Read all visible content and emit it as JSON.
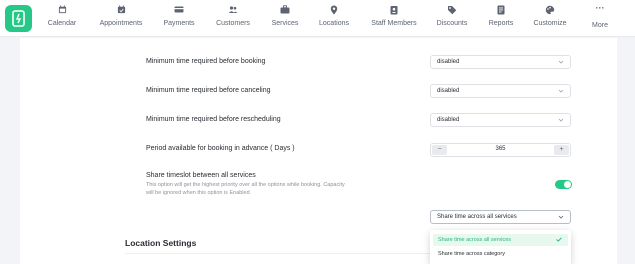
{
  "nav": {
    "items": [
      {
        "label": "Calendar",
        "icon": "calendar-icon"
      },
      {
        "label": "Appointments",
        "icon": "calendar-check-icon"
      },
      {
        "label": "Payments",
        "icon": "credit-card-icon"
      },
      {
        "label": "Customers",
        "icon": "users-icon"
      },
      {
        "label": "Services",
        "icon": "briefcase-icon"
      },
      {
        "label": "Locations",
        "icon": "map-pin-icon"
      },
      {
        "label": "Staff Members",
        "icon": "id-badge-icon"
      },
      {
        "label": "Discounts",
        "icon": "tag-icon"
      },
      {
        "label": "Reports",
        "icon": "report-icon"
      },
      {
        "label": "Customize",
        "icon": "palette-icon"
      }
    ],
    "more_label": "More"
  },
  "settings": {
    "min_before_booking": {
      "label": "Minimum time required before booking",
      "value": "disabled"
    },
    "min_before_canceling": {
      "label": "Minimum time required before canceling",
      "value": "disabled"
    },
    "min_before_rescheduling": {
      "label": "Minimum time required before rescheduling",
      "value": "disabled"
    },
    "advance_period": {
      "label": "Period available for booking in advance ( Days )",
      "value": "365",
      "minus": "−",
      "plus": "+"
    },
    "share_timeslot": {
      "label": "Share timeslot between all services",
      "description": "This option will get the highest priority over all the options while booking. Capacity will be ignored when this option is Enabled",
      "enabled": true,
      "value": "Share time across all services"
    }
  },
  "dropdown": {
    "options": [
      {
        "label": "Share time across all services",
        "selected": true
      },
      {
        "label": "Share time across category",
        "selected": false
      }
    ]
  },
  "section": {
    "title": "Location Settings"
  },
  "colors": {
    "accent": "#25c886",
    "text": "#292d32",
    "muted": "#8c929c"
  }
}
